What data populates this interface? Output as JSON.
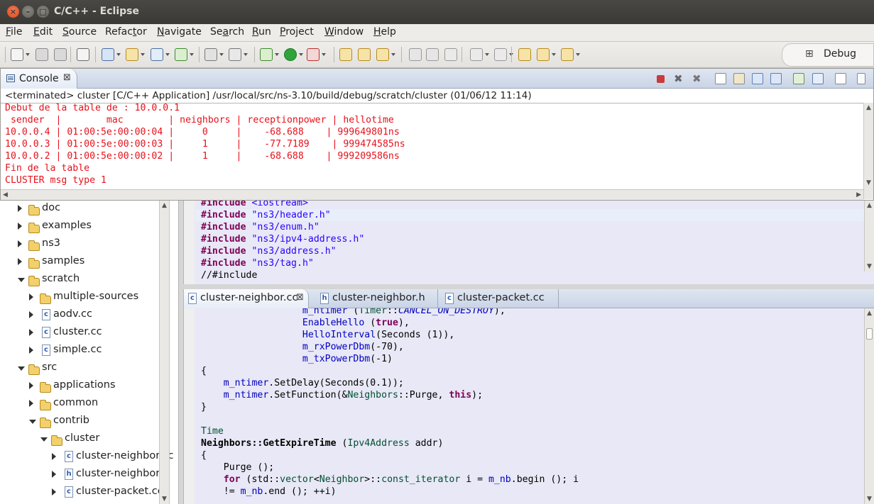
{
  "window": {
    "title": "C/C++ - Eclipse"
  },
  "menu": [
    "File",
    "Edit",
    "Source",
    "Refactor",
    "Navigate",
    "Search",
    "Run",
    "Project",
    "Window",
    "Help"
  ],
  "menu_mnemonic_index": [
    0,
    0,
    0,
    5,
    0,
    2,
    0,
    0,
    0,
    0
  ],
  "perspective": {
    "label": "Debug"
  },
  "console": {
    "tab_label": "Console",
    "status": "<terminated> cluster [C/C++ Application] /usr/local/src/ns-3.10/build/debug/scratch/cluster (01/06/12 11:14)",
    "lines": [
      "Debut de la table de : 10.0.0.1",
      " sender  |        mac        | neighbors | receptionpower | hellotime",
      "10.0.0.4 | 01:00:5e:00:00:04 |     0     |    -68.688    | 999649801ns",
      "10.0.0.3 | 01:00:5e:00:00:03 |     1     |    -77.7189    | 999474585ns",
      "10.0.0.2 | 01:00:5e:00:00:02 |     1     |    -68.688    | 999209586ns",
      "Fin de la table",
      "CLUSTER msg type 1"
    ],
    "text_color": "#e8111b"
  },
  "explorer": {
    "items": [
      {
        "label": "doc",
        "type": "folder",
        "level": 0,
        "state": "closed"
      },
      {
        "label": "examples",
        "type": "folder",
        "level": 0,
        "state": "closed"
      },
      {
        "label": "ns3",
        "type": "folder",
        "level": 0,
        "state": "closed"
      },
      {
        "label": "samples",
        "type": "folder",
        "level": 0,
        "state": "closed"
      },
      {
        "label": "scratch",
        "type": "folder",
        "level": 0,
        "state": "open"
      },
      {
        "label": "multiple-sources",
        "type": "folder",
        "level": 1,
        "state": "closed"
      },
      {
        "label": "aodv.cc",
        "type": "c",
        "level": 1,
        "state": "closed"
      },
      {
        "label": "cluster.cc",
        "type": "c",
        "level": 1,
        "state": "closed"
      },
      {
        "label": "simple.cc",
        "type": "c",
        "level": 1,
        "state": "closed"
      },
      {
        "label": "src",
        "type": "folder",
        "level": 0,
        "state": "open"
      },
      {
        "label": "applications",
        "type": "folder",
        "level": 1,
        "state": "closed"
      },
      {
        "label": "common",
        "type": "folder",
        "level": 1,
        "state": "closed"
      },
      {
        "label": "contrib",
        "type": "folder",
        "level": 1,
        "state": "open"
      },
      {
        "label": "cluster",
        "type": "folder",
        "level": 2,
        "state": "open"
      },
      {
        "label": "cluster-neighbor.cc",
        "type": "c",
        "level": 3,
        "state": "closed"
      },
      {
        "label": "cluster-neighbor.h",
        "type": "h",
        "level": 3,
        "state": "closed"
      },
      {
        "label": "cluster-packet.cc",
        "type": "c",
        "level": 3,
        "state": "closed"
      }
    ]
  },
  "editor_top": {
    "lines": [
      [
        [
          "kw",
          "#include"
        ],
        [
          "t",
          " "
        ],
        [
          "str",
          "<iostream>"
        ]
      ],
      [
        [
          "kw",
          "#include"
        ],
        [
          "t",
          " "
        ],
        [
          "str",
          "\"ns3/header.h\""
        ]
      ],
      [
        [
          "kw",
          "#include"
        ],
        [
          "t",
          " "
        ],
        [
          "str",
          "\"ns3/enum.h\""
        ]
      ],
      [
        [
          "kw",
          "#include"
        ],
        [
          "t",
          " "
        ],
        [
          "str",
          "\"ns3/ipv4-address.h\""
        ]
      ],
      [
        [
          "kw",
          "#include"
        ],
        [
          "t",
          " "
        ],
        [
          "str",
          "\"ns3/address.h\""
        ]
      ],
      [
        [
          "kw",
          "#include"
        ],
        [
          "t",
          " "
        ],
        [
          "str",
          "\"ns3/tag.h\""
        ]
      ],
      [
        [
          "t",
          "//#include"
        ]
      ]
    ]
  },
  "editor_tabs": [
    {
      "label": "cluster-neighbor.cc",
      "icon": "c",
      "active": true
    },
    {
      "label": "cluster-neighbor.h",
      "icon": "h",
      "active": false
    },
    {
      "label": "cluster-packet.cc",
      "icon": "c",
      "active": false
    }
  ],
  "editor_bottom": {
    "lines": [
      [
        [
          "t",
          "                  "
        ],
        [
          "field",
          "m_ntimer"
        ],
        [
          "t",
          " ("
        ],
        [
          "ty",
          "Timer"
        ],
        [
          "t",
          "::"
        ],
        [
          "field ital",
          "CANCEL_ON_DESTROY"
        ],
        [
          "t",
          "),"
        ]
      ],
      [
        [
          "t",
          "                  "
        ],
        [
          "field",
          "EnableHello"
        ],
        [
          "t",
          " ("
        ],
        [
          "kw",
          "true"
        ],
        [
          "t",
          "),"
        ]
      ],
      [
        [
          "t",
          "                  "
        ],
        [
          "field",
          "HelloInterval"
        ],
        [
          "t",
          "(Seconds (1)),"
        ]
      ],
      [
        [
          "t",
          "                  "
        ],
        [
          "field",
          "m_rxPowerDbm"
        ],
        [
          "t",
          "(-70),"
        ]
      ],
      [
        [
          "t",
          "                  "
        ],
        [
          "field",
          "m_txPowerDbm"
        ],
        [
          "t",
          "(-1)"
        ]
      ],
      [
        [
          "t",
          "{"
        ]
      ],
      [
        [
          "t",
          "    "
        ],
        [
          "field",
          "m_ntimer"
        ],
        [
          "t",
          "."
        ],
        [
          "t",
          "SetDelay"
        ],
        [
          "t",
          "(Seconds(0.1));"
        ]
      ],
      [
        [
          "t",
          "    "
        ],
        [
          "field",
          "m_ntimer"
        ],
        [
          "t",
          ".SetFunction(&"
        ],
        [
          "ty",
          "Neighbors"
        ],
        [
          "t",
          "::Purge, "
        ],
        [
          "kw",
          "this"
        ],
        [
          "t",
          ");"
        ]
      ],
      [
        [
          "t",
          "}"
        ]
      ],
      [
        [
          "t",
          ""
        ]
      ],
      [
        [
          "ty",
          "Time"
        ]
      ],
      [
        [
          "kwb",
          "Neighbors::GetExpireTime"
        ],
        [
          "t",
          " ("
        ],
        [
          "ty",
          "Ipv4Address"
        ],
        [
          "t",
          " addr)"
        ]
      ],
      [
        [
          "t",
          "{"
        ]
      ],
      [
        [
          "t",
          "    Purge ();"
        ]
      ],
      [
        [
          "t",
          "    "
        ],
        [
          "kw",
          "for"
        ],
        [
          "t",
          " (std::"
        ],
        [
          "ty",
          "vector"
        ],
        [
          "t",
          "<"
        ],
        [
          "ty",
          "Neighbor"
        ],
        [
          "t",
          ">::"
        ],
        [
          "ty",
          "const_iterator"
        ],
        [
          "t",
          " i = "
        ],
        [
          "field",
          "m_nb"
        ],
        [
          "t",
          ".begin (); i"
        ]
      ],
      [
        [
          "t",
          "    != "
        ],
        [
          "field",
          "m_nb"
        ],
        [
          "t",
          ".end (); ++i)"
        ]
      ]
    ]
  }
}
